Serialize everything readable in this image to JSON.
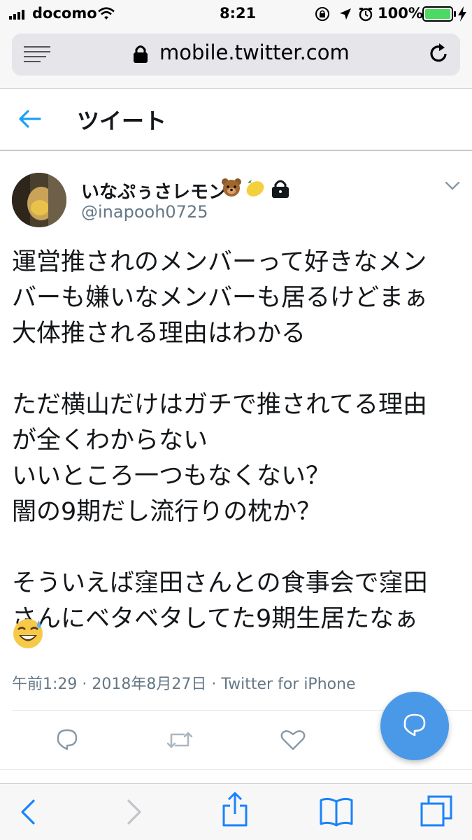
{
  "status_bar": {
    "carrier": "docomo",
    "time": "8:21",
    "battery": "100%"
  },
  "browser": {
    "url": "mobile.twitter.com"
  },
  "header": {
    "title": "ツイート"
  },
  "tweet": {
    "display_name": "いなぷぅさレモン",
    "handle": "@inapooh0725",
    "text": "運営推されのメンバーって好きなメン\nバーも嫌いなメンバーも居るけどまぁ\n大体推される理由はわかる\n\nただ横山だけはガチで推されてる理由\nが全くわからない\nいいところ一つもなくない？\n闇の9期だし流行りの枕か？\n\nそういえば窪田さんとの食事会で窪田\nさんにベタベタしてた9期生居たなぁ",
    "meta": "午前1:29 · 2018年8月27日 · Twitter for iPhone"
  },
  "colors": {
    "twitter_blue": "#4a99e9",
    "text": "#14171a",
    "secondary": "#657786"
  },
  "icons": {
    "back": "arrow-left-icon",
    "caret": "chevron-down-icon",
    "reply": "reply-icon",
    "retweet": "retweet-icon",
    "like": "heart-icon",
    "compose": "compose-reply-icon"
  }
}
